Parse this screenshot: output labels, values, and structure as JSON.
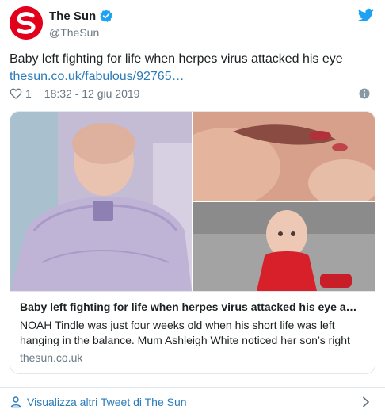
{
  "header": {
    "display_name": "The Sun",
    "handle": "@TheSun",
    "brand_color": "#e3001b",
    "twitter_color": "#1da1f2"
  },
  "tweet": {
    "text": "Baby left fighting for life when herpes virus attacked his eye",
    "link": "thesun.co.uk/fabulous/92765…"
  },
  "meta": {
    "likes": "1",
    "timestamp": "18:32 - 12 giu 2019"
  },
  "card": {
    "title": "Baby left fighting for life when herpes virus attacked his eye a…",
    "description": "NOAH Tindle was just four weeks old when his short life was left hanging in the balance. Mum Ashleigh White noticed her son’s right",
    "domain": "thesun.co.uk"
  },
  "footer": {
    "label": "Visualizza altri Tweet di The Sun"
  },
  "icons": [
    "sun-logo-icon",
    "verified-icon",
    "twitter-bird-icon",
    "heart-icon",
    "info-icon",
    "person-icon",
    "chevron-right-icon"
  ]
}
